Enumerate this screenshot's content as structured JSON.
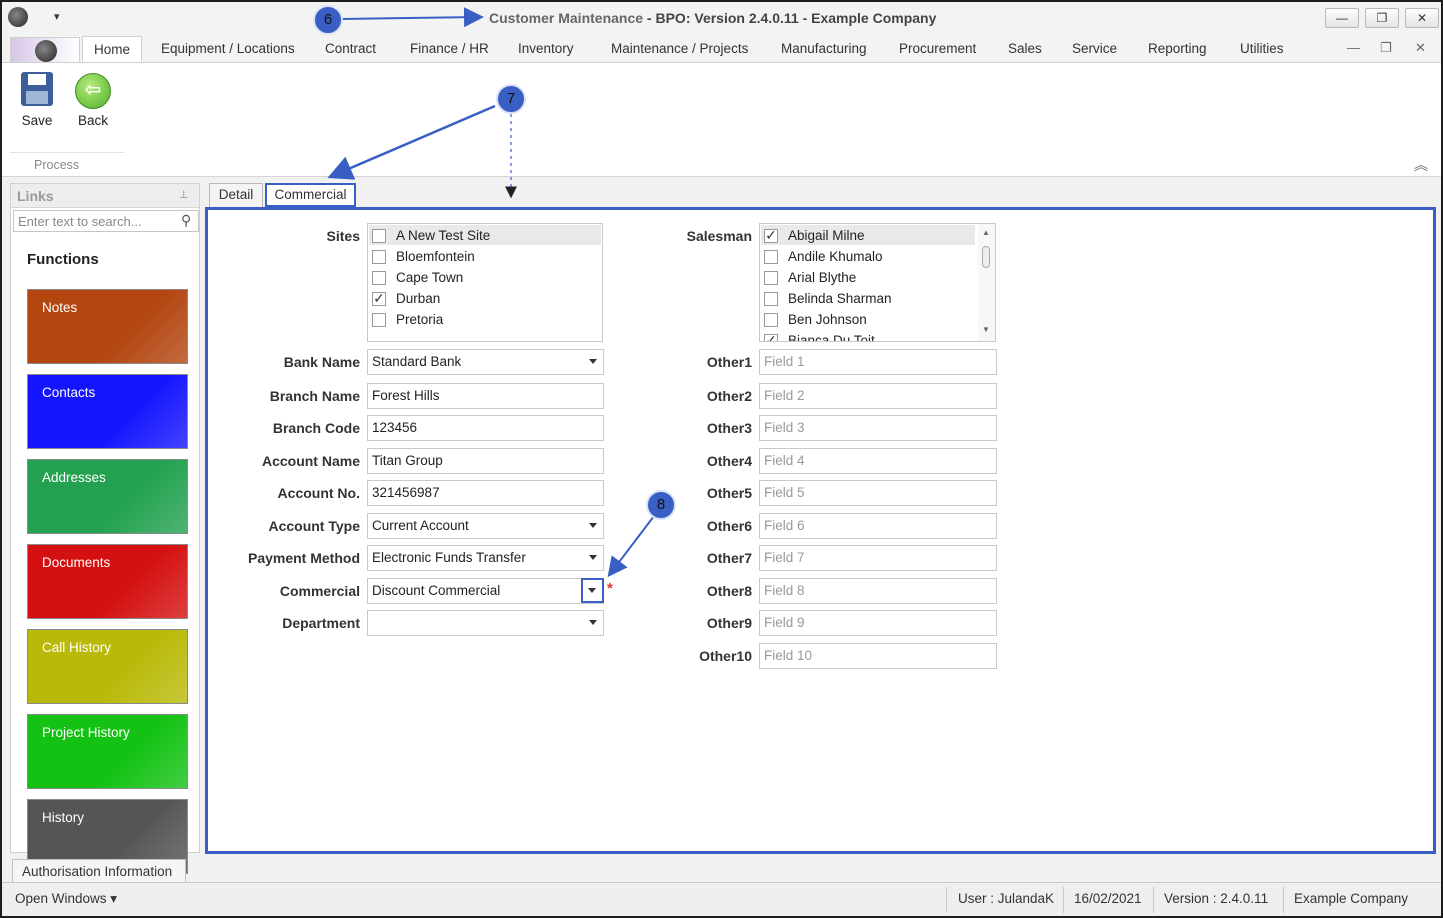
{
  "window": {
    "title_module": "Customer Maintenance",
    "title_rest": " - BPO: Version 2.4.0.11 - Example Company",
    "minimize": "—",
    "restore": "❐",
    "close": "✕"
  },
  "ribbon": {
    "tabs": [
      "Home",
      "Equipment / Locations",
      "Contract",
      "Finance / HR",
      "Inventory",
      "Maintenance / Projects",
      "Manufacturing",
      "Procurement",
      "Sales",
      "Service",
      "Reporting",
      "Utilities"
    ],
    "save_label": "Save",
    "back_label": "Back",
    "group_label": "Process"
  },
  "links": {
    "title": "Links",
    "search_placeholder": "Enter text to search...",
    "functions_title": "Functions",
    "tiles": [
      "Notes",
      "Contacts",
      "Addresses",
      "Documents",
      "Call History",
      "Project History",
      "History"
    ],
    "tile_colors": [
      "#b34510",
      "#1414ff",
      "#23a150",
      "#d41010",
      "#b9b90a",
      "#14c214",
      "#555555"
    ],
    "auth_tab": "Authorisation Information"
  },
  "doc_tabs": [
    "Detail",
    "Commercial"
  ],
  "form": {
    "sites_label": "Sites",
    "sites": [
      {
        "name": "A New Test Site",
        "checked": false
      },
      {
        "name": "Bloemfontein",
        "checked": false
      },
      {
        "name": "Cape Town",
        "checked": false
      },
      {
        "name": "Durban",
        "checked": true
      },
      {
        "name": "Pretoria",
        "checked": false
      }
    ],
    "salesman_label": "Salesman",
    "salesmen": [
      {
        "name": "Abigail Milne",
        "checked": true
      },
      {
        "name": "Andile Khumalo",
        "checked": false
      },
      {
        "name": "Arial Blythe",
        "checked": false
      },
      {
        "name": "Belinda Sharman",
        "checked": false
      },
      {
        "name": "Ben Johnson",
        "checked": false
      },
      {
        "name": "Bianca Du Toit",
        "checked": true
      }
    ],
    "fields": [
      {
        "label": "Bank Name",
        "value": "Standard Bank",
        "dropdown": true
      },
      {
        "label": "Branch Name",
        "value": "Forest Hills",
        "dropdown": false
      },
      {
        "label": "Branch Code",
        "value": "123456",
        "dropdown": false
      },
      {
        "label": "Account Name",
        "value": "Titan Group",
        "dropdown": false
      },
      {
        "label": "Account No.",
        "value": "321456987",
        "dropdown": false
      },
      {
        "label": "Account Type",
        "value": "Current Account",
        "dropdown": true
      },
      {
        "label": "Payment Method",
        "value": "Electronic Funds Transfer",
        "dropdown": true
      },
      {
        "label": "Commercial",
        "value": "Discount Commercial",
        "dropdown": true
      },
      {
        "label": "Department",
        "value": "",
        "dropdown": true
      }
    ],
    "others": [
      {
        "label": "Other1",
        "placeholder": "Field 1"
      },
      {
        "label": "Other2",
        "placeholder": "Field 2"
      },
      {
        "label": "Other3",
        "placeholder": "Field 3"
      },
      {
        "label": "Other4",
        "placeholder": "Field 4"
      },
      {
        "label": "Other5",
        "placeholder": "Field 5"
      },
      {
        "label": "Other6",
        "placeholder": "Field 6"
      },
      {
        "label": "Other7",
        "placeholder": "Field 7"
      },
      {
        "label": "Other8",
        "placeholder": "Field 8"
      },
      {
        "label": "Other9",
        "placeholder": "Field 9"
      },
      {
        "label": "Other10",
        "placeholder": "Field 10"
      }
    ],
    "required_mark": "*"
  },
  "callouts": [
    "6",
    "7",
    "8"
  ],
  "status": {
    "open_windows": "Open Windows ▾",
    "user": "User : JulandaK",
    "date": "16/02/2021",
    "version": "Version : 2.4.0.11",
    "company": "Example Company"
  },
  "accent_color": "#3a5fc4"
}
